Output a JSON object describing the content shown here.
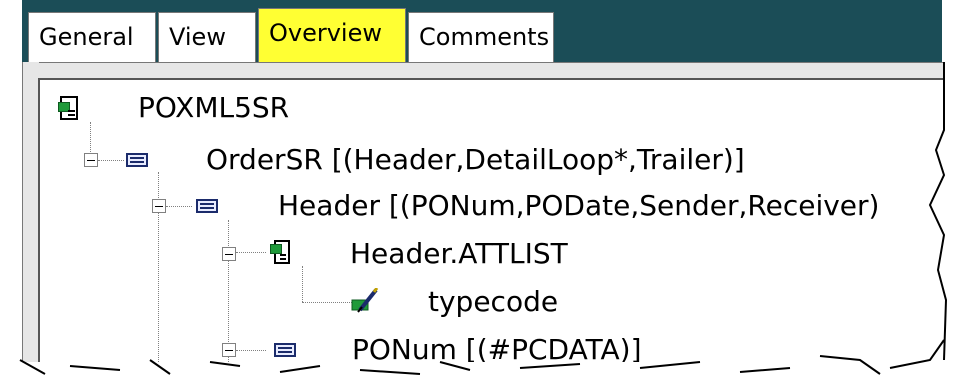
{
  "tabs": [
    {
      "label": "General",
      "active": false
    },
    {
      "label": "View",
      "active": false
    },
    {
      "label": "Overview",
      "active": true
    },
    {
      "label": "Comments",
      "active": false
    }
  ],
  "tree": {
    "root": {
      "label": "POXML5SR",
      "icon": "document-icon"
    },
    "nodes": [
      {
        "label": "OrderSR [(Header,DetailLoop*,Trailer)]",
        "icon": "element-icon"
      },
      {
        "label": "Header [(PONum,PODate,Sender,Receiver)",
        "icon": "element-icon"
      },
      {
        "label": "Header.ATTLIST",
        "icon": "attlist-icon"
      },
      {
        "label": "typecode",
        "icon": "attribute-icon"
      },
      {
        "label": "PONum [(#PCDATA)]",
        "icon": "element-icon"
      }
    ]
  },
  "colors": {
    "active_tab": "#ffff33",
    "background_dark": "#1b4d57",
    "element_icon": "#1b2b6b",
    "attlist_green": "#1f9a3a"
  }
}
